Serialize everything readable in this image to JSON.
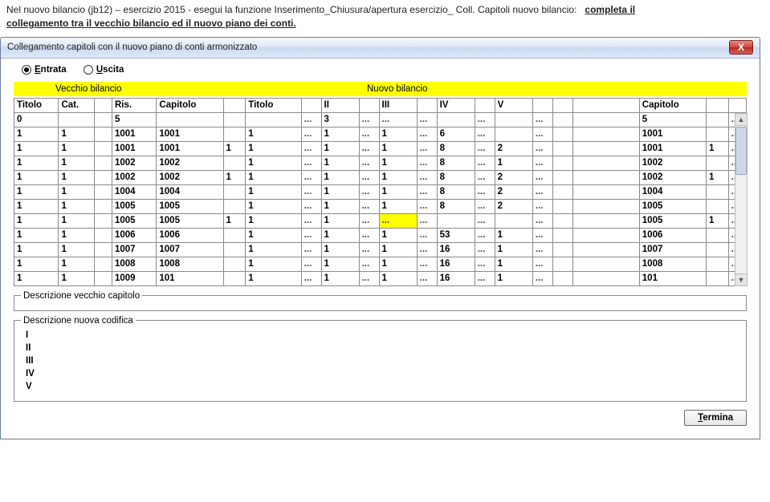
{
  "instruction": {
    "line1a": "Nel nuovo bilancio (jb12) – esercizio 2015 - esegui la funzione Inserimento_Chiusura/apertura esercizio_ Coll. Capitoli nuovo bilancio:",
    "line1b": "completa il",
    "line2": "collegamento tra il vecchio bilancio ed il nuovo piano dei conti."
  },
  "window": {
    "title": "Collegamento capitoli con il nuovo piano di conti armonizzato"
  },
  "radio": {
    "entrata": "Entrata",
    "uscita": "Uscita"
  },
  "section": {
    "left": "Vecchio bilancio",
    "right": "Nuovo bilancio"
  },
  "columns": {
    "titolo": "Titolo",
    "cat": "Cat.",
    "ris": "Ris.",
    "capitolo": "Capitolo",
    "titolo2": "Titolo",
    "ii": "II",
    "iii": "III",
    "iv": "IV",
    "v": "V",
    "capitolo2": "Capitolo"
  },
  "rows": [
    {
      "t": "0",
      "cat": "",
      "ris": "5",
      "cap": "",
      "sub": "",
      "t2": "",
      "ii": "3",
      "iii": "",
      "iv": "",
      "v": "",
      "cap2": "5",
      "sub2": ""
    },
    {
      "t": "1",
      "cat": "1",
      "ris": "1001",
      "cap": "1001",
      "sub": "",
      "t2": "1",
      "ii": "1",
      "iii": "1",
      "iv": "6",
      "v": "",
      "cap2": "1001",
      "sub2": ""
    },
    {
      "t": "1",
      "cat": "1",
      "ris": "1001",
      "cap": "1001",
      "sub": "1",
      "t2": "1",
      "ii": "1",
      "iii": "1",
      "iv": "8",
      "v": "2",
      "cap2": "1001",
      "sub2": "1"
    },
    {
      "t": "1",
      "cat": "1",
      "ris": "1002",
      "cap": "1002",
      "sub": "",
      "t2": "1",
      "ii": "1",
      "iii": "1",
      "iv": "8",
      "v": "1",
      "cap2": "1002",
      "sub2": ""
    },
    {
      "t": "1",
      "cat": "1",
      "ris": "1002",
      "cap": "1002",
      "sub": "1",
      "t2": "1",
      "ii": "1",
      "iii": "1",
      "iv": "8",
      "v": "2",
      "cap2": "1002",
      "sub2": "1"
    },
    {
      "t": "1",
      "cat": "1",
      "ris": "1004",
      "cap": "1004",
      "sub": "",
      "t2": "1",
      "ii": "1",
      "iii": "1",
      "iv": "8",
      "v": "2",
      "cap2": "1004",
      "sub2": ""
    },
    {
      "t": "1",
      "cat": "1",
      "ris": "1005",
      "cap": "1005",
      "sub": "",
      "t2": "1",
      "ii": "1",
      "iii": "1",
      "iv": "8",
      "v": "2",
      "cap2": "1005",
      "sub2": ""
    },
    {
      "t": "1",
      "cat": "1",
      "ris": "1005",
      "cap": "1005",
      "sub": "1",
      "t2": "1",
      "ii": "1",
      "iii": "",
      "iv": "",
      "v": "",
      "cap2": "1005",
      "sub2": "1",
      "hl": true
    },
    {
      "t": "1",
      "cat": "1",
      "ris": "1006",
      "cap": "1006",
      "sub": "",
      "t2": "1",
      "ii": "1",
      "iii": "1",
      "iv": "53",
      "v": "1",
      "cap2": "1006",
      "sub2": ""
    },
    {
      "t": "1",
      "cat": "1",
      "ris": "1007",
      "cap": "1007",
      "sub": "",
      "t2": "1",
      "ii": "1",
      "iii": "1",
      "iv": "16",
      "v": "1",
      "cap2": "1007",
      "sub2": ""
    },
    {
      "t": "1",
      "cat": "1",
      "ris": "1008",
      "cap": "1008",
      "sub": "",
      "t2": "1",
      "ii": "1",
      "iii": "1",
      "iv": "16",
      "v": "1",
      "cap2": "1008",
      "sub2": ""
    },
    {
      "t": "1",
      "cat": "1",
      "ris": "1009",
      "cap": "101",
      "sub": "",
      "t2": "1",
      "ii": "1",
      "iii": "1",
      "iv": "16",
      "v": "1",
      "cap2": "101",
      "sub2": ""
    }
  ],
  "fieldsets": {
    "old": "Descrizione vecchio capitolo",
    "new": "Descrizione nuova codifica",
    "new_rows": {
      "i": "I",
      "ii": "II",
      "iii": "III",
      "iv": "IV",
      "v": "V"
    }
  },
  "buttons": {
    "termina": "Termina"
  }
}
